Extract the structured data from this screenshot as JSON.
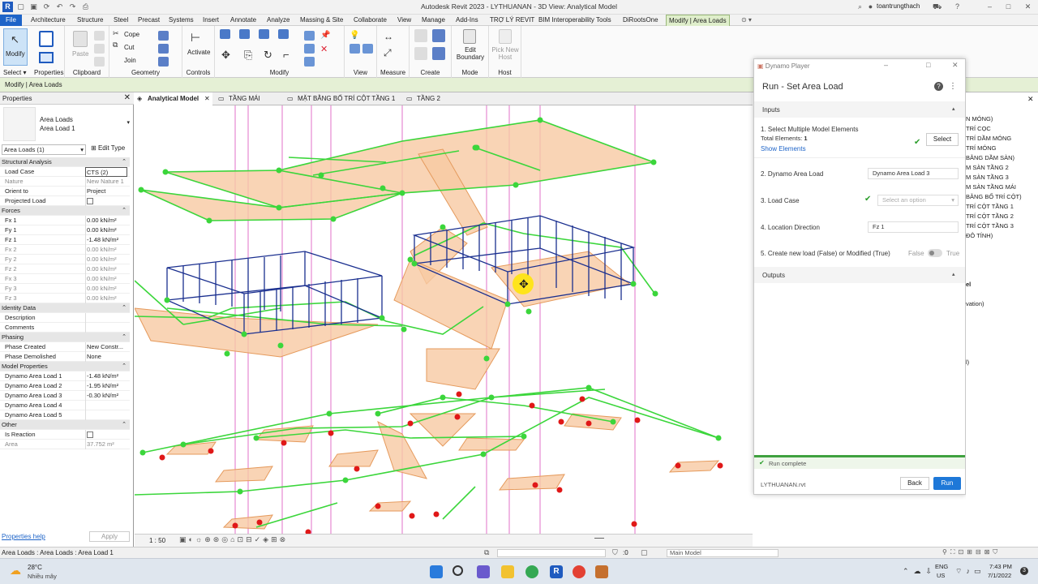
{
  "window": {
    "title": "Autodesk Revit 2023 - LYTHUANAN - 3D View: Analytical Model",
    "user": "toantrungthach"
  },
  "tabs": [
    "File",
    "Architecture",
    "Structure",
    "Steel",
    "Precast",
    "Systems",
    "Insert",
    "Annotate",
    "Analyze",
    "Massing & Site",
    "Collaborate",
    "View",
    "Manage",
    "Add-Ins",
    "TRỢ LÝ REVIT",
    "BIM Interoperability Tools",
    "DiRootsOne",
    "Modify | Area Loads"
  ],
  "ribbon": {
    "modify": "Modify",
    "select": "Select ▾",
    "properties": "Properties",
    "paste": "Paste",
    "cope": "Cope",
    "cut": "Cut",
    "join": "Join",
    "clipboard": "Clipboard",
    "geometry": "Geometry",
    "activate": "Activate",
    "controls": "Controls",
    "modify_group": "Modify",
    "view_group": "View",
    "measure": "Measure",
    "create": "Create",
    "edit_boundary": "Edit Boundary",
    "mode": "Mode",
    "pick_new_host": "Pick New Host",
    "host": "Host"
  },
  "context_bar": "Modify | Area Loads",
  "properties": {
    "title": "Properties",
    "type_line1": "Area Loads",
    "type_line2": "Area Load 1",
    "selector": "Area Loads (1)",
    "edit_type": "Edit Type",
    "rows": [
      {
        "k": "Structural Analysis",
        "cat": true
      },
      {
        "k": "Load Case",
        "v": "CTS (2)"
      },
      {
        "k": "Nature",
        "v": "New Nature 1",
        "grey": true
      },
      {
        "k": "Orient to",
        "v": "Project"
      },
      {
        "k": "Projected Load",
        "chk": true
      },
      {
        "k": "Forces",
        "cat": true
      },
      {
        "k": "Fx 1",
        "v": "0.00 kN/m²"
      },
      {
        "k": "Fy 1",
        "v": "0.00 kN/m²"
      },
      {
        "k": "Fz 1",
        "v": "-1.48 kN/m²"
      },
      {
        "k": "Fx 2",
        "v": "0.00 kN/m²",
        "grey": true
      },
      {
        "k": "Fy 2",
        "v": "0.00 kN/m²",
        "grey": true
      },
      {
        "k": "Fz 2",
        "v": "0.00 kN/m²",
        "grey": true
      },
      {
        "k": "Fx 3",
        "v": "0.00 kN/m²",
        "grey": true
      },
      {
        "k": "Fy 3",
        "v": "0.00 kN/m²",
        "grey": true
      },
      {
        "k": "Fz 3",
        "v": "0.00 kN/m²",
        "grey": true
      },
      {
        "k": "Identity Data",
        "cat": true
      },
      {
        "k": "Description",
        "v": ""
      },
      {
        "k": "Comments",
        "v": ""
      },
      {
        "k": "Phasing",
        "cat": true
      },
      {
        "k": "Phase Created",
        "v": "New Constr..."
      },
      {
        "k": "Phase Demolished",
        "v": "None"
      },
      {
        "k": "Model Properties",
        "cat": true
      },
      {
        "k": "Dynamo Area Load 1",
        "v": "-1.48 kN/m²"
      },
      {
        "k": "Dynamo Area Load 2",
        "v": "-1.95 kN/m²"
      },
      {
        "k": "Dynamo Area Load 3",
        "v": "-0.30 kN/m²"
      },
      {
        "k": "Dynamo Area Load 4",
        "v": ""
      },
      {
        "k": "Dynamo Area Load 5",
        "v": ""
      },
      {
        "k": "Other",
        "cat": true
      },
      {
        "k": "Is Reaction",
        "chk": true
      },
      {
        "k": "Area",
        "v": "37.752 m²",
        "grey": true
      }
    ],
    "help": "Properties help",
    "apply": "Apply"
  },
  "view_tabs": [
    "Analytical Model",
    "TẦNG MÁI",
    "MẶT BẰNG BỐ TRÍ CỘT TẦNG 1",
    "TẦNG 2"
  ],
  "view_control": {
    "scale": "1 : 50"
  },
  "dynamo": {
    "app": "Dynamo Player",
    "title": "Run - Set Area Load",
    "inputs": "Inputs",
    "in1": "1. Select Multiple Model Elements",
    "in1_total_label": "Total Elements:",
    "in1_total": "1",
    "show_elements": "Show Elements",
    "select_btn": "Select",
    "in2": "2. Dynamo Area Load",
    "in2_val": "Dynamo Area Load 3",
    "in3": "3. Load Case",
    "in3_ph": "Select an option",
    "in4": "4. Location Direction",
    "in4_val": "Fz 1",
    "in5": "5. Create new load (False) or Modified (True)",
    "false": "False",
    "true": "True",
    "outputs": "Outputs",
    "status": "Run complete",
    "file": "LYTHUANAN.rvt",
    "back": "Back",
    "run": "Run"
  },
  "browser_items": [
    "N MÓNG)",
    "TRÍ CỌC",
    "TRÍ DẦM MÓNG",
    "TRÍ MÓNG",
    "BẰNG DẦM SÀN)",
    "M SÀN TẦNG 2",
    "M SÀN TẦNG 3",
    "M SÀN TẦNG MÁI",
    "BẰNG BỐ TRÍ CỘT)",
    "TRÍ CỘT TẦNG 1",
    "TRÍ CỘT TẦNG 2",
    "TRÍ CỘT TẦNG 3",
    "ĐÔ TÍNH)"
  ],
  "browser_extra": [
    "el",
    "vation)",
    "l)"
  ],
  "status": {
    "text": "Area Loads : Area Loads : Area Load 1",
    "zero": ":0",
    "model": "Main Model"
  },
  "taskbar": {
    "temp": "28°C",
    "weather": "Nhiều mây",
    "lang1": "ENG",
    "lang2": "US",
    "time": "7:43 PM",
    "date": "7/1/2022",
    "badge": "3"
  },
  "colors": {
    "accent": "#1e64c8",
    "green": "#3ad63a",
    "load": "#f7c9a3",
    "ctx": "#e5f0d5",
    "magenta": "#e070c8",
    "frame": "#2b3a9a"
  }
}
